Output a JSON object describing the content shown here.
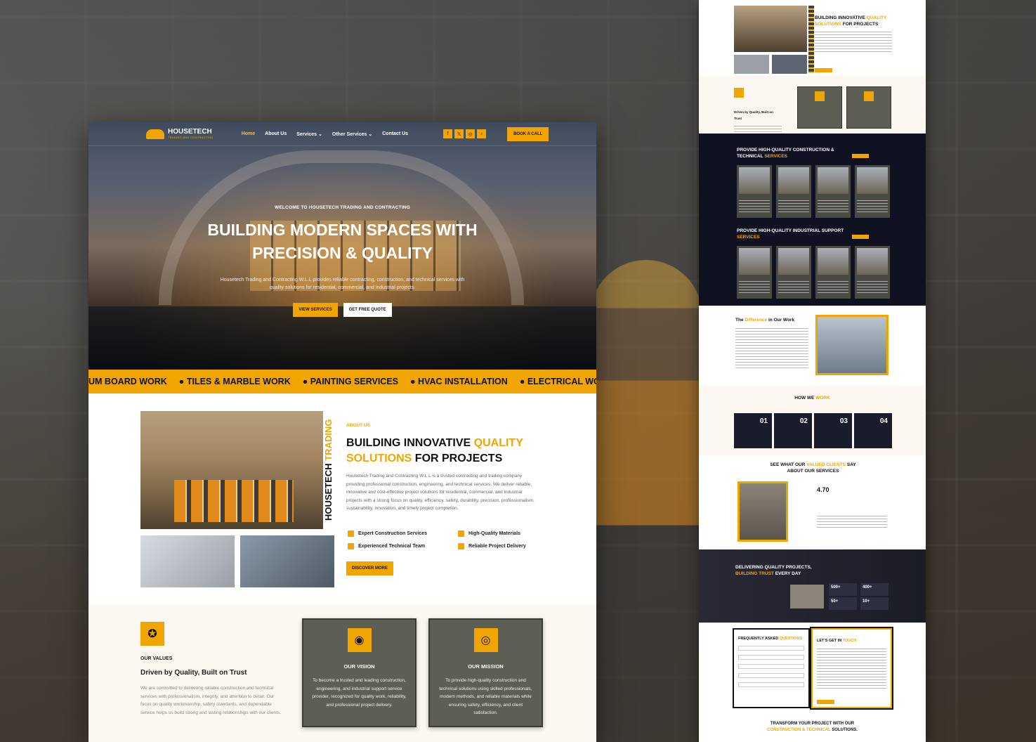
{
  "nav": {
    "logo_title": "HOUSETECH",
    "logo_sub": "TRADING AND CONTRACTING",
    "items": [
      "Home",
      "About Us",
      "Services ⌄",
      "Other Services ⌄",
      "Contact Us"
    ],
    "socials": [
      "f",
      "𝕏",
      "◎",
      "♪"
    ],
    "book_label": "BOOK A CALL"
  },
  "hero": {
    "kicker": "WELCOME TO HOUSETECH TRADING AND CONTRACTING",
    "title_line1": "BUILDING MODERN SPACES WITH",
    "title_line2": "PRECISION & QUALITY",
    "text": "Housetech Trading and Contracting W.L.L provides reliable contracting, construction, and technical services with quality solutions for residential, commercial, and industrial projects.",
    "btn_primary": "VIEW SERVICES",
    "btn_secondary": "GET FREE QUOTE"
  },
  "ticker": [
    "UM BOARD WORK",
    "● TILES & MARBLE WORK",
    "● PAINTING SERVICES",
    "● HVAC INSTALLATION",
    "● ELECTRICAL WOR"
  ],
  "about": {
    "side_dark": "HOUSETECH ",
    "side_yellow": "TRADING",
    "kicker": "ABOUT US",
    "title_a": "BUILDING INNOVATIVE ",
    "title_b": "QUALITY SOLUTIONS",
    "title_c": " FOR PROJECTS",
    "text": "Housetech Trading and Contracting W.L.L is a trusted contracting and trading company providing professional construction, engineering, and technical services. We deliver reliable, innovative and cost-effective project solutions for residential, commercial, and industrial projects with a strong focus on quality, efficiency, safety, durability, precision, professionalism, sustainability, innovation, and timely project completion.",
    "features": [
      "Expert Construction Services",
      "High-Quality Materials",
      "Experienced Technical Team",
      "Reliable Project Delivery"
    ],
    "btn": "DISCOVER MORE"
  },
  "values": {
    "kicker": "OUR VALUES",
    "title": "Driven by Quality, Built on Trust",
    "text": "We are committed to delivering reliable construction and technical services with professionalism, integrity, and attention to detail. Our focus on quality workmanship, safety standards, and dependable service helps us build strong and lasting relationships with our clients.",
    "vision_title": "OUR VISION",
    "vision_text": "To become a trusted and leading construction, engineering, and industrial support service provider, recognized for quality work, reliability, and professional project delivery.",
    "mission_title": "OUR MISSION",
    "mission_text": "To provide high-quality construction and technical solutions using skilled professionals, modern methods, and reliable materials while ensuring safety, efficiency, and client satisfaction."
  },
  "preview": {
    "about_title_a": "BUILDING INNOVATIVE ",
    "about_title_b": "QUALITY SOLUTIONS",
    "about_title_c": " FOR PROJECTS",
    "values_title": "Driven by Quality, Built on Trust",
    "services_title_a": "PROVIDE HIGH-QUALITY CONSTRUCTION & TECHNICAL ",
    "services_title_b": "SERVICES",
    "industrial_title_a": "PROVIDE HIGH-QUALITY INDUSTRIAL SUPPORT ",
    "industrial_title_b": "SERVICES",
    "diff_title_a": "The ",
    "diff_title_b": "Difference",
    "diff_title_c": " in Our Work",
    "how_title_a": "HOW WE ",
    "how_title_b": "WORK",
    "steps": [
      "01",
      "02",
      "03",
      "04"
    ],
    "testi_title_a": "SEE WHAT OUR ",
    "testi_title_b": "VALUED CLIENTS",
    "testi_title_c": " SAY ABOUT OUR SERVICES",
    "rating": "4.70",
    "cta_title_a": "DELIVERING QUALITY PROJECTS,",
    "cta_title_b": "BUILDING TRUST",
    "cta_title_c": " EVERY DAY",
    "stats": [
      "500+",
      "400+",
      "50+",
      "10+"
    ],
    "faq_title_a": "FREQUENTLY ASKED ",
    "faq_title_b": "QUESTIONS",
    "contact_title_a": "LET'S GET IN ",
    "contact_title_b": "TOUCH",
    "footer_cta_a": "TRANSFORM YOUR PROJECT WITH OUR",
    "footer_cta_b": "CONSTRUCTION & TECHNICAL",
    "footer_cta_c": " SOLUTIONS."
  }
}
